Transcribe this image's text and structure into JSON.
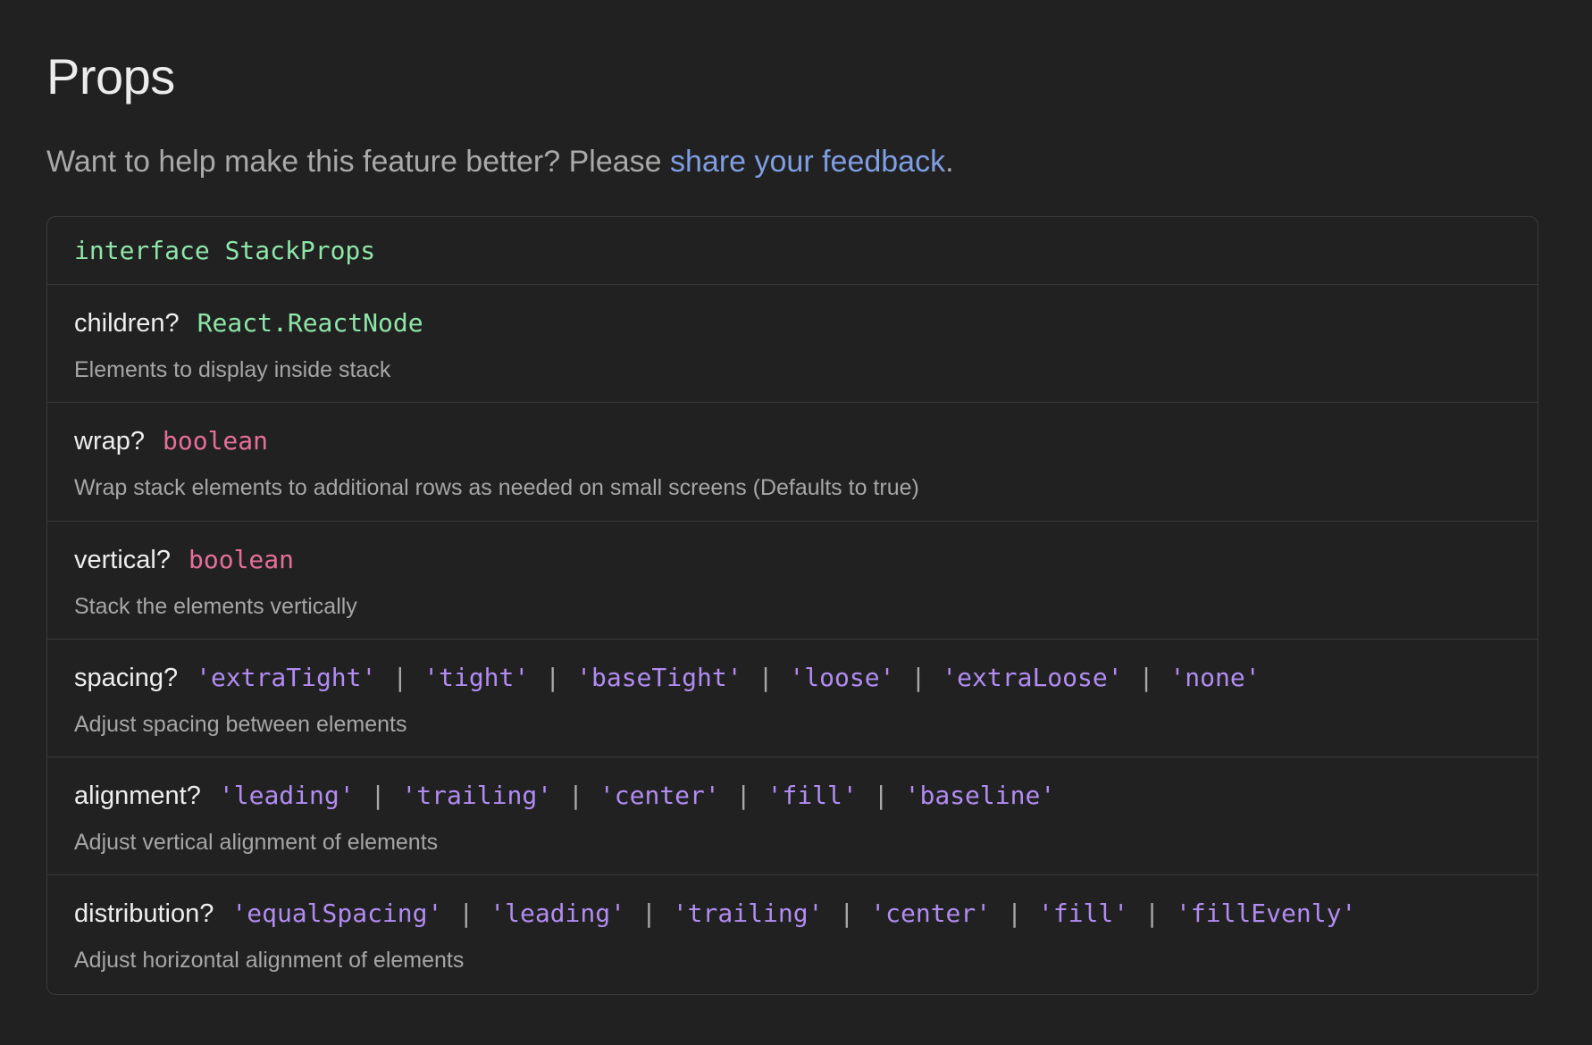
{
  "title": "Props",
  "intro": {
    "text": "Want to help make this feature better? Please ",
    "link_text": "share your feedback",
    "suffix": "."
  },
  "interface_header": "interface StackProps",
  "props": [
    {
      "name": "children?",
      "type_kind": "green",
      "types": [
        "React.ReactNode"
      ],
      "description": "Elements to display inside stack"
    },
    {
      "name": "wrap?",
      "type_kind": "pink",
      "types": [
        "boolean"
      ],
      "description": "Wrap stack elements to additional rows as needed on small screens (Defaults to true)"
    },
    {
      "name": "vertical?",
      "type_kind": "pink",
      "types": [
        "boolean"
      ],
      "description": "Stack the elements vertically"
    },
    {
      "name": "spacing?",
      "type_kind": "purple",
      "types": [
        "'extraTight'",
        "'tight'",
        "'baseTight'",
        "'loose'",
        "'extraLoose'",
        "'none'"
      ],
      "description": "Adjust spacing between elements"
    },
    {
      "name": "alignment?",
      "type_kind": "purple",
      "types": [
        "'leading'",
        "'trailing'",
        "'center'",
        "'fill'",
        "'baseline'"
      ],
      "description": "Adjust vertical alignment of elements"
    },
    {
      "name": "distribution?",
      "type_kind": "purple",
      "types": [
        "'equalSpacing'",
        "'leading'",
        "'trailing'",
        "'center'",
        "'fill'",
        "'fillEvenly'"
      ],
      "description": "Adjust horizontal alignment of elements"
    }
  ],
  "pipe_symbol": "|",
  "colors": {
    "background": "#212121",
    "border": "#3a3a3a",
    "link": "#7f9ee3",
    "type_green": "#8ee6a8",
    "type_pink": "#e66f9a",
    "type_purple": "#b18cf2"
  }
}
